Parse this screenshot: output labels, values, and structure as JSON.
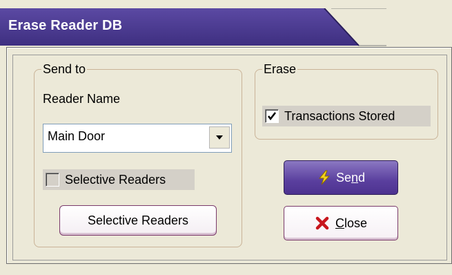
{
  "window": {
    "title": "Erase Reader DB",
    "title_color": "#4b3a8c"
  },
  "send_to_group": {
    "legend": "Send to",
    "reader_name_label": "Reader Name",
    "reader_select_value": "Main Door",
    "selective_readers_checkbox": {
      "label": "Selective Readers",
      "checked": false
    },
    "selective_readers_button_label": "Selective Readers"
  },
  "erase_group": {
    "legend": "Erase",
    "transactions_checkbox": {
      "label": "Transactions Stored",
      "checked": true
    }
  },
  "buttons": {
    "send": {
      "label_prefix": "Se",
      "label_mnemonic": "n",
      "label_suffix": "d",
      "icon": "lightning-icon"
    },
    "close": {
      "label_mnemonic": "C",
      "label_suffix": "lose",
      "icon": "red-x-icon"
    }
  }
}
